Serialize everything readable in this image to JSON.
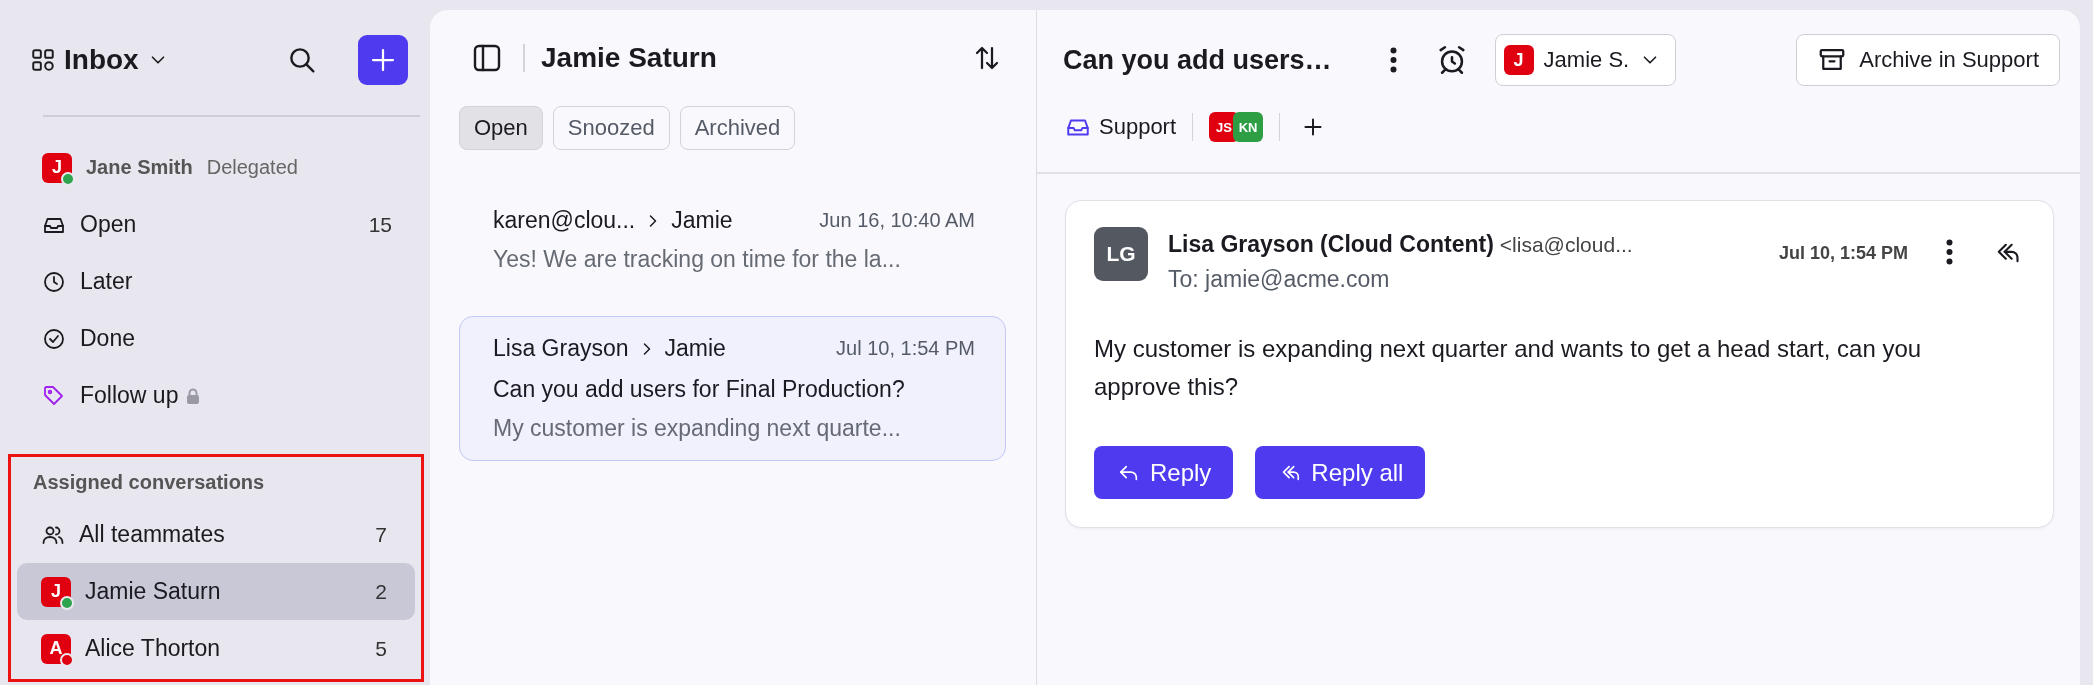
{
  "sidebar": {
    "title": "Inbox",
    "owner": {
      "initial": "J",
      "name": "Jane Smith",
      "status": "Delegated",
      "color": "#2ea44f"
    },
    "items": [
      {
        "kind": "inbox",
        "label": "Open",
        "count": "15",
        "locked": false,
        "selected": false
      },
      {
        "kind": "clock",
        "label": "Later",
        "locked": false,
        "selected": false
      },
      {
        "kind": "check",
        "label": "Done",
        "locked": false,
        "selected": false
      },
      {
        "kind": "tag",
        "label": "Follow up",
        "locked": true,
        "selected": false
      }
    ],
    "assigned": {
      "title": "Assigned conversations",
      "highlighted": true,
      "items": [
        {
          "kind": "team",
          "label": "All teammates",
          "count": "7",
          "selected": false
        },
        {
          "kind": "avatar",
          "initial": "J",
          "label": "Jamie Saturn",
          "count": "2",
          "color": "#2ea44f",
          "selected": true
        },
        {
          "kind": "avatar",
          "initial": "A",
          "label": "Alice Thorton",
          "count": "5",
          "color": "#e0000f",
          "selected": false
        }
      ]
    }
  },
  "list": {
    "title": "Jamie Saturn",
    "tabs": [
      {
        "label": "Open",
        "selected": true
      },
      {
        "label": "Snoozed",
        "selected": false
      },
      {
        "label": "Archived",
        "selected": false
      }
    ],
    "conversations": [
      {
        "from": "karen@clou...",
        "to": "Jamie",
        "time": "Jun 16, 10:40 AM",
        "preview": "Yes! We are tracking on time for the la...",
        "selected": false
      },
      {
        "from": "Lisa Grayson",
        "to": "Jamie",
        "time": "Jul 10, 1:54 PM",
        "subject": "Can you add users for Final Production?",
        "preview": "My customer is expanding next quarte...",
        "selected": true
      }
    ]
  },
  "detail": {
    "title": "Can you add users…",
    "assignee": {
      "initial": "J",
      "name": "Jamie S."
    },
    "archive_button": "Archive in Support",
    "inbox": "Support",
    "participants": [
      {
        "initials": "JS",
        "color": "#e0000f"
      },
      {
        "initials": "KN",
        "color": "#2e9e44"
      }
    ],
    "message": {
      "initials": "LG",
      "sender": "Lisa Grayson (Cloud Content)",
      "address": "<lisa@cloud...",
      "to": "To: jamie@acme.com",
      "time": "Jul 10, 1:54 PM",
      "body": "My customer is expanding next quarter and wants to get a head start, can you approve this?",
      "buttons": [
        {
          "kind": "reply",
          "label": "Reply"
        },
        {
          "kind": "reply_all",
          "label": "Reply all"
        }
      ]
    }
  }
}
